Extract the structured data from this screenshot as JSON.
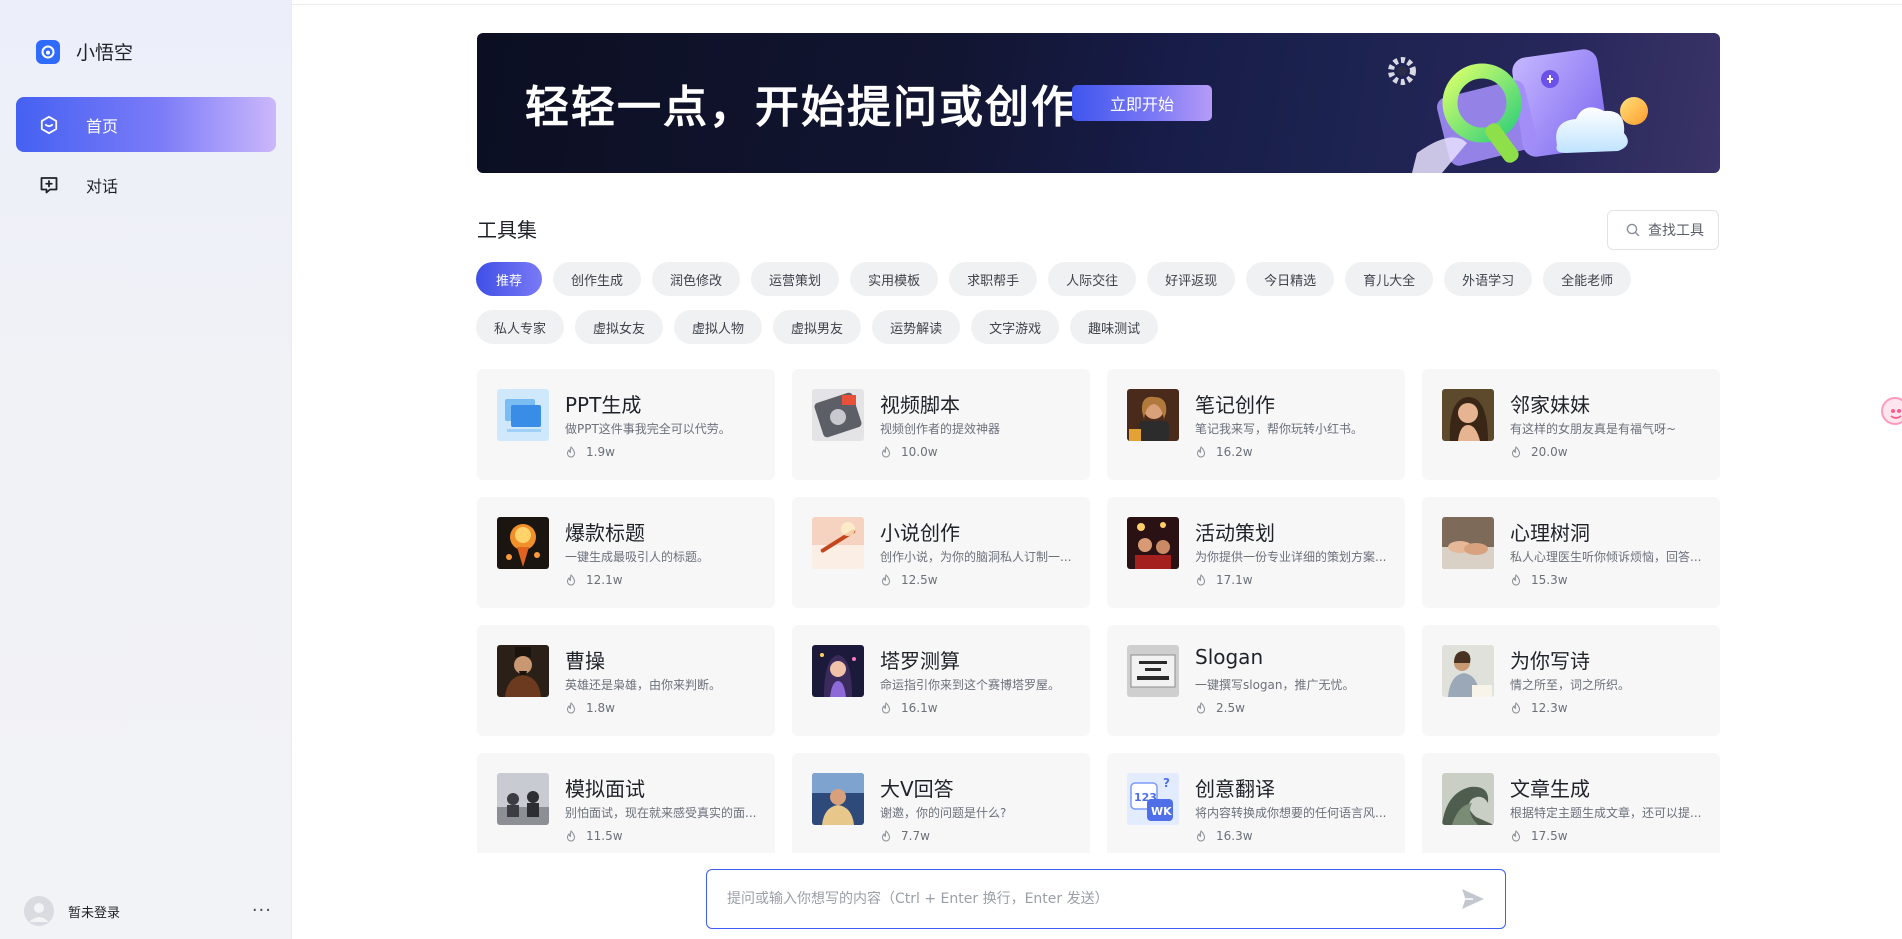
{
  "brand": {
    "name": "小悟空"
  },
  "nav": [
    {
      "label": "首页",
      "icon": "home-hexagon-icon",
      "active": true
    },
    {
      "label": "对话",
      "icon": "chat-plus-icon",
      "active": false
    }
  ],
  "user": {
    "name": "暂未登录",
    "more": "···"
  },
  "banner": {
    "title": "轻轻一点，开始提问或创作",
    "button": "立即开始"
  },
  "tools": {
    "title": "工具集",
    "search_label": "查找工具",
    "categories_row1": [
      "推荐",
      "创作生成",
      "润色修改",
      "运营策划",
      "实用模板",
      "求职帮手",
      "人际交往",
      "好评返现",
      "今日精选",
      "育儿大全",
      "外语学习",
      "全能老师"
    ],
    "categories_row2": [
      "私人专家",
      "虚拟女友",
      "虚拟人物",
      "虚拟男友",
      "运势解读",
      "文字游戏",
      "趣味测试"
    ],
    "active_category": "推荐"
  },
  "cards": [
    {
      "title": "PPT生成",
      "desc": "做PPT这件事我完全可以代劳。",
      "count": "1.9w"
    },
    {
      "title": "视频脚本",
      "desc": "视频创作者的提效神器",
      "count": "10.0w"
    },
    {
      "title": "笔记创作",
      "desc": "笔记我来写，帮你玩转小红书。",
      "count": "16.2w"
    },
    {
      "title": "邻家妹妹",
      "desc": "有这样的女朋友真是有福气呀~",
      "count": "20.0w"
    },
    {
      "title": "爆款标题",
      "desc": "一键生成最吸引人的标题。",
      "count": "12.1w"
    },
    {
      "title": "小说创作",
      "desc": "创作小说，为你的脑洞私人订制一...",
      "count": "12.5w"
    },
    {
      "title": "活动策划",
      "desc": "为你提供一份专业详细的策划方案...",
      "count": "17.1w"
    },
    {
      "title": "心理树洞",
      "desc": "私人心理医生听你倾诉烦恼，回答...",
      "count": "15.3w"
    },
    {
      "title": "曹操",
      "desc": "英雄还是枭雄，由你来判断。",
      "count": "1.8w"
    },
    {
      "title": "塔罗测算",
      "desc": "命运指引你来到这个赛博塔罗屋。",
      "count": "16.1w"
    },
    {
      "title": "Slogan",
      "desc": "一键撰写slogan，推广无忧。",
      "count": "2.5w"
    },
    {
      "title": "为你写诗",
      "desc": "情之所至，词之所织。",
      "count": "12.3w"
    },
    {
      "title": "模拟面试",
      "desc": "别怕面试，现在就来感受真实的面...",
      "count": "11.5w"
    },
    {
      "title": "大V回答",
      "desc": "谢邀，你的问题是什么?",
      "count": "7.7w"
    },
    {
      "title": "创意翻译",
      "desc": "将内容转换成你想要的任何语言风...",
      "count": "16.3w"
    },
    {
      "title": "文章生成",
      "desc": "根据特定主题生成文章，还可以提...",
      "count": "17.5w"
    }
  ],
  "chat": {
    "placeholder": "提问或输入你想写的内容（Ctrl + Enter 换行，Enter 发送）"
  },
  "colors": {
    "accent": "#3f5cf5",
    "card_bg": "#f7f7f8",
    "chip_bg": "#f0f1f3",
    "sidebar_bg": "#eef0f7"
  }
}
